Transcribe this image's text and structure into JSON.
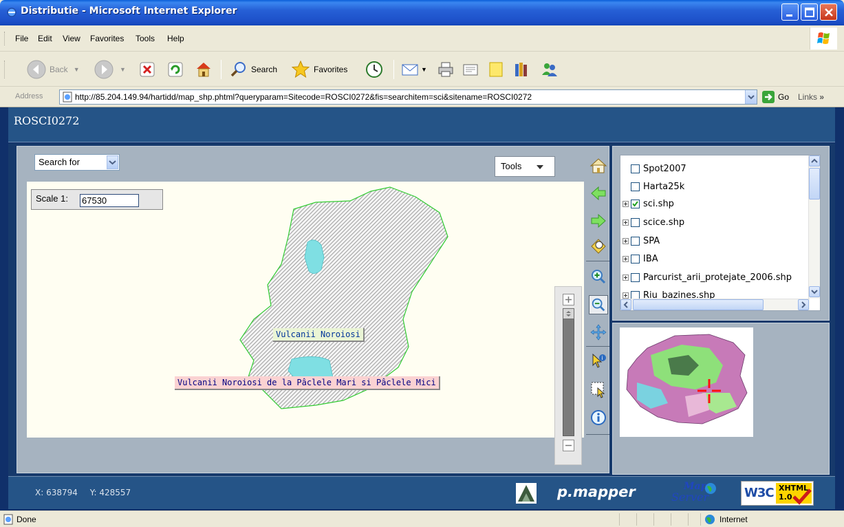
{
  "window": {
    "title": "Distributie - Microsoft Internet Explorer"
  },
  "menu": {
    "items": [
      "File",
      "Edit",
      "View",
      "Favorites",
      "Tools",
      "Help"
    ]
  },
  "toolbar": {
    "back": "Back",
    "search": "Search",
    "favorites": "Favorites"
  },
  "address": {
    "label": "Address",
    "url": "http://85.204.149.94/hartidd/map_shp.phtml?queryparam=Sitecode=ROSCI0272&fis=searchitem=sci&sitename=ROSCI0272",
    "go": "Go",
    "links": "Links"
  },
  "page": {
    "sitecode": "ROSCI0272",
    "search_for": "Search for",
    "tools": "Tools",
    "scale_label": "Scale 1:",
    "scale_value": "67530",
    "map_labels": [
      "Vulcanii Noroiosi",
      "Vulcanii Noroiosi de la Pâclele Mari si Pâclele Mici"
    ],
    "layers": [
      {
        "name": "Spot2007",
        "checked": false,
        "expandable": false
      },
      {
        "name": "Harta25k",
        "checked": false,
        "expandable": false
      },
      {
        "name": "sci.shp",
        "checked": true,
        "expandable": true
      },
      {
        "name": "scice.shp",
        "checked": false,
        "expandable": true
      },
      {
        "name": "SPA",
        "checked": false,
        "expandable": true
      },
      {
        "name": "IBA",
        "checked": false,
        "expandable": true
      },
      {
        "name": "Parcurist_arii_protejate_2006.shp",
        "checked": false,
        "expandable": true
      },
      {
        "name": "Riu_bazines.shp",
        "checked": false,
        "expandable": true
      }
    ],
    "coords": {
      "x": "X: 638794",
      "y": "Y: 428557"
    },
    "brand": "p.mapper",
    "w3c": {
      "xhtml": "XHTML",
      "version": "1.0"
    },
    "mapserver": {
      "map": "Map",
      "server": "Server"
    }
  },
  "status": {
    "text": "Done",
    "zone": "Internet"
  },
  "colors": {
    "titlebar": "#2660d6",
    "page_bg": "#10306a",
    "header": "#255487",
    "map_bg": "#fffef2",
    "polygon_outline": "#33cc33"
  }
}
